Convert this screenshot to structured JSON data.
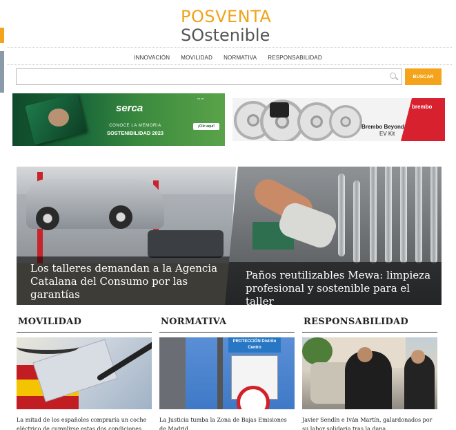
{
  "site": {
    "logo_line1": "POSVENTA",
    "logo_line2": "SOstenible"
  },
  "nav": {
    "items": [
      "INNOVACIÓN",
      "MOVILIDAD",
      "NORMATIVA",
      "RESPONSABILIDAD"
    ]
  },
  "search": {
    "placeholder": "",
    "button_label": "BUSCAR",
    "icon": "search-icon"
  },
  "ads": {
    "serca": {
      "brand": "serca",
      "line1": "CONOCE LA MEMORIA",
      "line2": "SOSTENIBILIDAD 2023",
      "cta": "¡Clic aquí!"
    },
    "brembo": {
      "brand": "brembo",
      "headline": "Brembo Beyond",
      "subline": "EV Kit"
    }
  },
  "hero": [
    {
      "title": "Los talleres demandan a la Agencia Catalana del Consumo por las garantías"
    },
    {
      "title": "Paños reutilizables Mewa: limpieza profesional y sostenible para el taller"
    }
  ],
  "sections": [
    {
      "heading": "MOVILIDAD",
      "article_title": "La mitad de los españoles compraría un coche eléctrico de cumplirse estas dos condiciones"
    },
    {
      "heading": "NORMATIVA",
      "article_title": "La Justicia tumba la Zona de Bajas Emisiones de Madrid",
      "sign_text": "PROTECCIÓN Distrito Centro"
    },
    {
      "heading": "RESPONSABILIDAD",
      "article_title": "Javier Sendín e Iván Martín, galardonados por su labor solidaria tras la dana"
    }
  ],
  "colors": {
    "accent_orange": "#f5a31a",
    "logo_green": "#3f8a3a",
    "brembo_red": "#d8212f"
  }
}
